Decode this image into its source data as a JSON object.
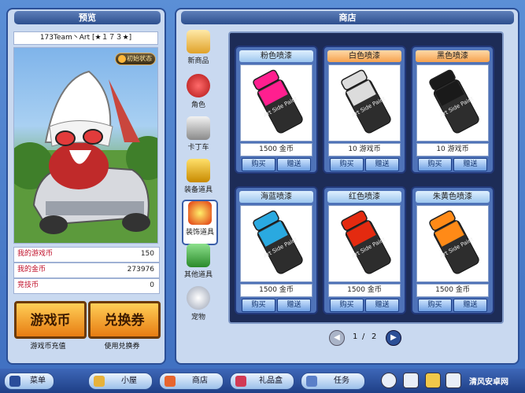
{
  "preview": {
    "title": "预览",
    "player": "173Team丶Art [★１７３★]",
    "action_label": "初始状态",
    "stats": [
      {
        "label": "我的游戏币",
        "value": "150"
      },
      {
        "label": "我的金币",
        "value": "273976"
      },
      {
        "label": "竞技币",
        "value": "0"
      }
    ],
    "buttons": [
      {
        "label": "游戏币",
        "caption": "游戏币充值"
      },
      {
        "label": "兑换券",
        "caption": "使用兑换券"
      }
    ]
  },
  "shop": {
    "title": "商店",
    "categories": [
      "新商品",
      "角色",
      "卡丁车",
      "装备道具",
      "装饰道具",
      "其他道具",
      "宠物"
    ],
    "active_category": "装饰道具",
    "items": [
      {
        "name": "粉色喷漆",
        "price": "1500 金币",
        "color": "#ff1f8f",
        "title_style": "blue"
      },
      {
        "name": "白色喷漆",
        "price": "10 游戏币",
        "color": "#dcdcdc",
        "title_style": "orange"
      },
      {
        "name": "黑色喷漆",
        "price": "10 游戏币",
        "color": "#1a1a1a",
        "title_style": "orange"
      },
      {
        "name": "海蓝喷漆",
        "price": "1500 金币",
        "color": "#2aa9e0",
        "title_style": "blue"
      },
      {
        "name": "红色喷漆",
        "price": "1500 金币",
        "color": "#e42a10",
        "title_style": "blue"
      },
      {
        "name": "朱黄色喷漆",
        "price": "1500 金币",
        "color": "#ff8a17",
        "title_style": "blue"
      }
    ],
    "buy_label": "购买",
    "gift_label": "赠送",
    "can_label": "Art Side Paint",
    "pagination": {
      "current": "1",
      "separator": "/",
      "total": "2"
    }
  },
  "taskbar": {
    "menu": "菜单",
    "home": "小屋",
    "shop": "商店",
    "gift": "礼品盒",
    "task": "任务",
    "watermark": "清风安卓网"
  }
}
